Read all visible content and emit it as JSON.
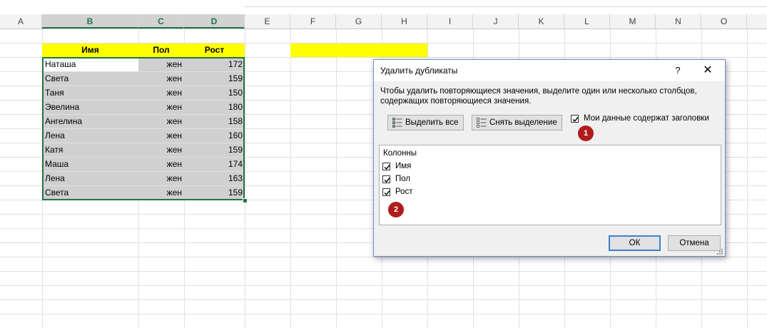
{
  "columns": [
    "A",
    "B",
    "C",
    "D",
    "E",
    "F",
    "G",
    "H",
    "I",
    "J",
    "K",
    "L",
    "M",
    "N",
    "O"
  ],
  "selected_columns": [
    "B",
    "C",
    "D"
  ],
  "table": {
    "headers": [
      "Имя",
      "Пол",
      "Рост"
    ],
    "rows": [
      [
        "Наташа",
        "жен",
        "172"
      ],
      [
        "Света",
        "жен",
        "159"
      ],
      [
        "Таня",
        "жен",
        "150"
      ],
      [
        "Эвелина",
        "жен",
        "180"
      ],
      [
        "Ангелина",
        "жен",
        "158"
      ],
      [
        "Лена",
        "жен",
        "160"
      ],
      [
        "Катя",
        "жен",
        "159"
      ],
      [
        "Маша",
        "жен",
        "174"
      ],
      [
        "Лена",
        "жен",
        "163"
      ],
      [
        "Света",
        "жен",
        "159"
      ]
    ]
  },
  "dialog": {
    "title": "Удалить дубликаты",
    "help_label": "?",
    "close_label": "✕",
    "description": "Чтобы удалить повторяющиеся значения, выделите один или несколько столбцов, содержащих повторяющиеся значения.",
    "select_all_label": "Выделить все",
    "unselect_all_label": "Снять выделение",
    "headers_checkbox_label": "Мои данные содержат заголовки",
    "headers_checked": true,
    "columns_title": "Колонны",
    "column_items": [
      {
        "label": "Имя",
        "checked": true
      },
      {
        "label": "Пол",
        "checked": true
      },
      {
        "label": "Рост",
        "checked": true
      }
    ],
    "ok_label": "ОК",
    "cancel_label": "Отмена"
  },
  "badges": [
    "1",
    "2"
  ],
  "colors": {
    "excel_green": "#217346",
    "highlight_yellow": "#ffff00",
    "badge_red": "#b01c1c",
    "selection_grey": "#d0d0d0"
  }
}
